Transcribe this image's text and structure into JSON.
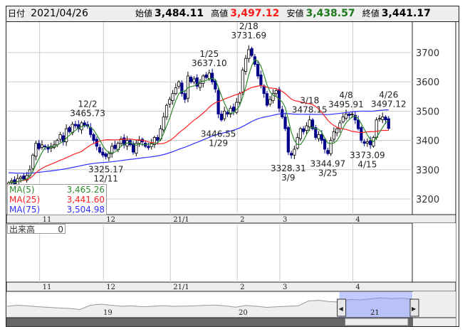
{
  "header": {
    "date_label": "日付",
    "date": "2021/04/26",
    "open_label": "始値",
    "open": "3,484.11",
    "high_label": "高値",
    "high": "3,497.12",
    "low_label": "安値",
    "low": "3,438.57",
    "close_label": "終値",
    "close": "3,441.17"
  },
  "colors": {
    "up": "#ffffff",
    "down": "#00008b",
    "ma5": "#2e8b2e",
    "ma25": "#ff2020",
    "ma75": "#3030ff",
    "high_text": "#ff0000",
    "low_text": "#1a7a1a"
  },
  "legend": [
    {
      "label": "MA(5)",
      "value": "3,465.26"
    },
    {
      "label": "MA(25)",
      "value": "3,441.60"
    },
    {
      "label": "MA(75)",
      "value": "3,504.98"
    }
  ],
  "volume": {
    "label": "出来高",
    "value": "0"
  },
  "chart_data": {
    "type": "candlestick",
    "ylim": [
      3150,
      3790
    ],
    "yticks": [
      "3200",
      "3300",
      "3400",
      "3500",
      "3600",
      "3700"
    ],
    "xticks": [
      {
        "label": "11",
        "i": 6
      },
      {
        "label": "12",
        "i": 27
      },
      {
        "label": "21/1",
        "i": 49
      },
      {
        "label": "2",
        "i": 71
      },
      {
        "label": "3",
        "i": 85
      },
      {
        "label": "4",
        "i": 109
      }
    ],
    "closes": [
      3255,
      3262,
      3250,
      3270,
      3275,
      3268,
      3280,
      3300,
      3350,
      3390,
      3372,
      3385,
      3378,
      3370,
      3380,
      3385,
      3400,
      3420,
      3395,
      3440,
      3430,
      3455,
      3450,
      3440,
      3460,
      3450,
      3448,
      3420,
      3400,
      3380,
      3360,
      3350,
      3345,
      3355,
      3380,
      3372,
      3390,
      3405,
      3385,
      3400,
      3385,
      3360,
      3390,
      3400,
      3395,
      3380,
      3375,
      3390,
      3410,
      3400,
      3440,
      3480,
      3520,
      3540,
      3560,
      3580,
      3600,
      3560,
      3540,
      3620,
      3600,
      3610,
      3585,
      3595,
      3620,
      3615,
      3630,
      3600,
      3575,
      3490,
      3470,
      3500,
      3490,
      3510,
      3500,
      3530,
      3560,
      3640,
      3680,
      3710,
      3690,
      3660,
      3620,
      3590,
      3560,
      3520,
      3540,
      3560,
      3570,
      3510,
      3480,
      3440,
      3360,
      3350,
      3370,
      3410,
      3440,
      3430,
      3450,
      3470,
      3440,
      3410,
      3420,
      3400,
      3370,
      3355,
      3400,
      3430,
      3440,
      3460,
      3480,
      3490,
      3485,
      3490,
      3470,
      3440,
      3400,
      3390,
      3395,
      3385,
      3410,
      3470,
      3475,
      3480,
      3470,
      3441
    ],
    "annotations": [
      {
        "date": "12/2",
        "value": "3465.73",
        "i": 26,
        "pos": "above"
      },
      {
        "date": "12/11",
        "value": "3325.17",
        "i": 32,
        "pos": "below"
      },
      {
        "date": "1/25",
        "value": "3637.10",
        "i": 66,
        "pos": "above"
      },
      {
        "date": "1/29",
        "value": "3446.55",
        "i": 69,
        "pos": "below"
      },
      {
        "date": "2/18",
        "value": "3731.69",
        "i": 79,
        "pos": "above"
      },
      {
        "date": "3/9",
        "value": "3328.31",
        "i": 92,
        "pos": "below"
      },
      {
        "date": "3/18",
        "value": "3478.15",
        "i": 99,
        "pos": "above"
      },
      {
        "date": "3/25",
        "value": "3344.97",
        "i": 105,
        "pos": "below"
      },
      {
        "date": "4/8",
        "value": "3495.91",
        "i": 111,
        "pos": "above"
      },
      {
        "date": "4/15",
        "value": "3373.09",
        "i": 118,
        "pos": "below"
      },
      {
        "date": "4/26",
        "value": "3497.12",
        "i": 125,
        "pos": "above"
      }
    ],
    "navigator": {
      "labels": [
        "19",
        "20",
        "21"
      ],
      "series": [
        3,
        3.5,
        3.2,
        2.8,
        2.5,
        2.2,
        2.0,
        1.5,
        3.5,
        4,
        3.5,
        3,
        3.2,
        2.8,
        3,
        3.3,
        3,
        3.1,
        3.2,
        3.4,
        3.6,
        3.2,
        2.6,
        3.4,
        3,
        2.5,
        2.8,
        3,
        3.2,
        5.5,
        5.8,
        5.2,
        5.0,
        6.2,
        6.0,
        6.5,
        7.0,
        6.6,
        6.8,
        6.4
      ],
      "selected_from_fraction": 0.82
    }
  }
}
